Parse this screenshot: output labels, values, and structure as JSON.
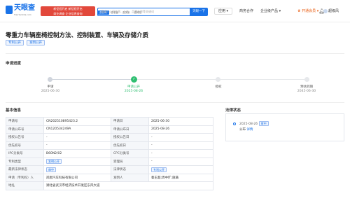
{
  "header": {
    "logo_text": "天眼查",
    "logo_sub": "TianYanCha.com",
    "ad_line1": "新征程开启  新征程开启",
    "ad_line2": "商业调查 企业信息查询",
    "search_tabs": [
      "查公司",
      "查老板",
      "查关系",
      "查风险"
    ],
    "search_placeholder": "请输入公司名称、人名、品牌名称等关键词",
    "search_button": "天眼一下",
    "app_label": "应用",
    "nav_items": [
      "商务合作",
      "企业级产品"
    ],
    "vip_label": "开通会员",
    "user_name": "超级风"
  },
  "patent": {
    "title": "零重力车辆座椅控制方法、控制装置、车辆及存储介质",
    "tags": [
      "专利公开",
      "发明公开"
    ]
  },
  "progress": {
    "section_title": "申请进度",
    "steps": [
      {
        "label": "申请",
        "date": "2025-06-30",
        "state": "done"
      },
      {
        "label": "申请公开",
        "date": "2025-08-26",
        "state": "current"
      },
      {
        "label": "授权",
        "date": "",
        "state": "pending"
      },
      {
        "label": "预估到期",
        "date": "2045-06-30",
        "state": "pending"
      }
    ]
  },
  "basic_info": {
    "section_title": "基本信息",
    "rows": [
      {
        "k1": "申请号",
        "v1": "CN202510895423.2",
        "k2": "申请日",
        "v2": "2025-06-30"
      },
      {
        "k1": "申请公布号",
        "v1": "CN120534249A",
        "k2": "申请公布日",
        "v2": "2025-08-26"
      },
      {
        "k1": "授权公告号",
        "v1": "-",
        "k2": "授权公告日",
        "v2": "-"
      },
      {
        "k1": "优先权号",
        "v1": "-",
        "k2": "优先权日",
        "v2": "-"
      },
      {
        "k1": "IPC分类号",
        "v1": "B60N2/02",
        "k2": "CPC分类号",
        "v2": "-"
      },
      {
        "k1": "专利类型",
        "v1": "发明公开",
        "k2": "受理局",
        "v2": "-"
      },
      {
        "k1": "最新法律状态",
        "v1": "审中",
        "k2": "法律状态",
        "v2": "专利公开"
      },
      {
        "k1": "申请（专利权）人",
        "v1": "岚图汽车科技有限公司",
        "k2": "发明人",
        "v2": "秦王超;周中旷;施满"
      },
      {
        "k1": "地址",
        "v1": "湖北省武汉市经济技术开发区东风大道",
        "k2": "",
        "v2": ""
      }
    ]
  },
  "legal_status": {
    "section_title": "法律状态",
    "entries": [
      {
        "date": "2025-08-26",
        "badge": "审中",
        "state": "公布",
        "link": "详情"
      }
    ]
  },
  "colors": {
    "accent": "#1a73e8",
    "done": "#d0d5dd",
    "current": "#2fbf71",
    "pending": "#c0c4cc"
  }
}
